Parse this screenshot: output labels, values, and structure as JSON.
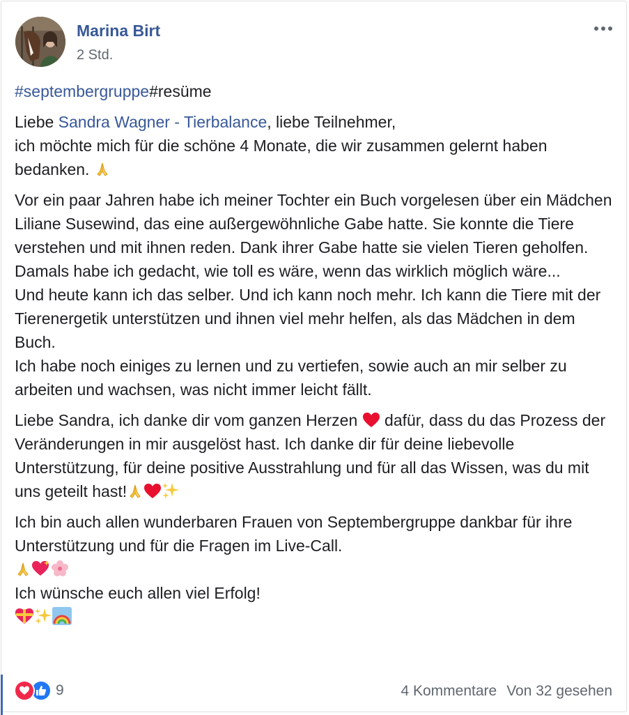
{
  "post": {
    "author": "Marina Birt",
    "time": "2 Std.",
    "hashtag1": "#septembergruppe",
    "hashtag2": "#resüme",
    "greeting_prefix": "Liebe ",
    "mention": "Sandra Wagner - Tierbalance",
    "greeting_suffix": ", liebe Teilnehmer,",
    "p1_line2": "ich möchte mich für die schöne 4 Monate, die wir zusammen gelernt haben bedanken.",
    "p2": [
      "Vor ein paar Jahren habe ich meiner Tochter ein Buch vorgelesen über ein Mädchen Liliane Susewind, das eine außergewöhnliche Gabe hatte. Sie konnte die Tiere verstehen und mit ihnen reden. Dank ihrer Gabe hatte sie vielen Tieren geholfen. Damals habe ich gedacht, wie toll es wäre, wenn das wirklich möglich wäre...",
      "Und heute kann ich das selber. Und ich kann noch mehr. Ich kann die Tiere mit der Tierenergetik unterstützen und ihnen viel mehr helfen, als das Mädchen in dem Buch.",
      "Ich habe noch einiges zu lernen und zu vertiefen, sowie auch an mir selber zu arbeiten und wachsen, was nicht immer leicht fällt."
    ],
    "p3_part1": "Liebe Sandra, ich danke dir vom ganzen Herzen",
    "p3_part2": "dafür, dass du das Prozess der Veränderungen in mir ausgelöst hast. Ich danke dir für deine liebevolle Unterstützung, für deine positive Ausstrahlung und für all das Wissen, was du mit uns geteilt hast!",
    "p4_line1": "Ich bin auch allen wunderbaren Frauen von Septembergruppe dankbar für ihre Unterstützung und für die Fragen im Live-Call.",
    "p4_line3": "Ich wünsche euch allen viel Erfolg!"
  },
  "footer": {
    "reaction_count": "9",
    "comments": "4 Kommentare",
    "seen": "Von 32 gesehen"
  },
  "icons": {
    "more": "more-options-icon",
    "love": "love-reaction-icon",
    "like": "like-reaction-icon",
    "pray": "folded-hands-emoji",
    "heart": "red-heart-emoji",
    "sparkles": "sparkles-emoji",
    "sparkling_heart": "sparkling-heart-emoji",
    "blossom": "cherry-blossom-emoji",
    "gift_heart": "heart-with-ribbon-emoji",
    "rainbow": "rainbow-emoji"
  },
  "colors": {
    "link": "#385898",
    "text": "#1c1e21",
    "meta": "#606770",
    "love": "#f0284a",
    "like": "#2078f4"
  }
}
